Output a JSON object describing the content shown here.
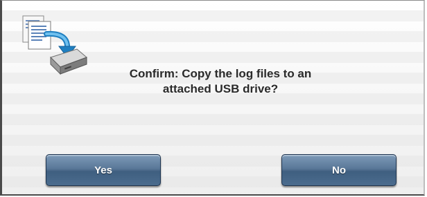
{
  "dialog": {
    "message_line1": "Confirm: Copy the log files to an",
    "message_line2": "attached USB drive?",
    "icon": "copy-to-usb-drive-icon",
    "yes_label": "Yes",
    "no_label": "No"
  },
  "colors": {
    "button_top": "#7d9ab8",
    "button_bottom": "#3f5f80",
    "button_text": "#ffffff",
    "message_text": "#2a2a2a"
  }
}
